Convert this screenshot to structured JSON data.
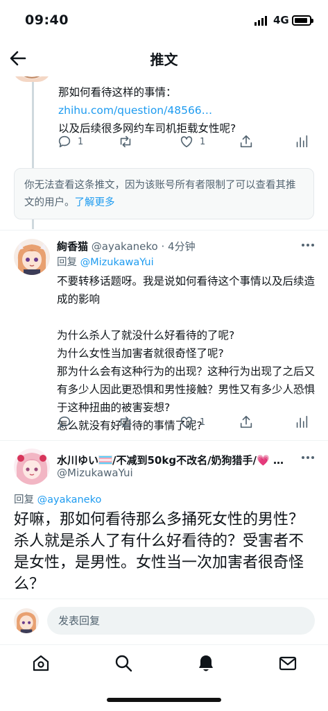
{
  "status": {
    "time": "09:40",
    "network": "4G"
  },
  "header": {
    "title": "推文",
    "back_icon": "arrow-left-icon"
  },
  "tweet1": {
    "text_prefix": "那如何看待这样的事情：",
    "link": "zhihu.com/question/48566…",
    "text_suffix": "以及后续很多网约车司机拒载女性呢?",
    "replies": "1",
    "retweets": "",
    "likes": "1"
  },
  "notice": {
    "text": "你无法查看这条推文，因为该账号所有者限制了可以查看其推文的用户。",
    "more": "了解更多"
  },
  "tweet2": {
    "display_name": "絢香猫",
    "handle": "@ayakaneko · 4分钟",
    "reply_prefix": "回复 ",
    "reply_to": "@MizukawaYui",
    "body": "不要转移话题呀。我是说如何看待这个事情以及后续造成的影响\n\n为什么杀人了就没什么好看待的了呢?\n为什么女性当加害者就很奇怪了呢?\n那为什么会有这种行为的出现？这种行为出现了之后又有多少人因此更恐惧和男性接触？男性又有多少人恐惧于这种扭曲的被害妄想?\n怎么就没有好看待的事情了呢?",
    "replies": "",
    "retweets": "",
    "likes": "1"
  },
  "tweet3": {
    "display_name_a": "水川ゆい",
    "display_name_b": "/不减到50kg不改名/奶狗猎手/",
    "display_name_heart": "💗",
    "display_name_tail": "…",
    "handle": "@MizukawaYui",
    "reply_prefix": "回复 ",
    "reply_to": "@ayakaneko",
    "body": "好嘛，那如何看待那么多捅死女性的男性？杀人就是杀人了有什么好看待的？受害者不是女性，是男性。女性当一次加害者很奇怪么？"
  },
  "compose": {
    "placeholder": "发表回复"
  },
  "nav": [
    "home-icon",
    "search-icon",
    "notifications-bell-icon",
    "messages-mail-icon"
  ],
  "colors": {
    "accent": "#1d9bf0",
    "muted": "#536471",
    "notice_bg": "#f7f9f9"
  }
}
